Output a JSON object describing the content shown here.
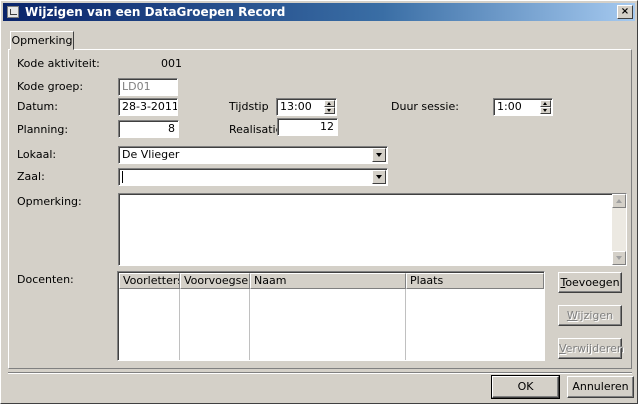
{
  "window": {
    "title": "Wijzigen van een DataGroepen Record",
    "close_label": "×"
  },
  "tabs": [
    {
      "label": "Opmerking"
    }
  ],
  "form": {
    "kode_aktiviteit_label": "Kode aktiviteit:",
    "kode_aktiviteit_value": "001",
    "kode_groep_label": "Kode groep:",
    "kode_groep_value": "LD01",
    "datum_label": "Datum:",
    "datum_value": "28-3-2011",
    "tijdstip_label": "Tijdstip",
    "tijdstip_value": "13:00",
    "duur_label": "Duur sessie:",
    "duur_value": "1:00",
    "planning_label": "Planning:",
    "planning_value": "8",
    "realisatie_label": "Realisatie:",
    "realisatie_value": "12",
    "lokaal_label": "Lokaal:",
    "lokaal_value": "De Vlieger",
    "zaal_label": "Zaal:",
    "zaal_value": "",
    "opmerking_label": "Opmerking:",
    "opmerking_value": "",
    "docenten_label": "Docenten:"
  },
  "docenten_table": {
    "columns": [
      "Voorletters",
      "Voorvoegsel",
      "Naam",
      "Plaats"
    ],
    "rows": []
  },
  "side_buttons": {
    "toevoegen_accel": "T",
    "toevoegen_rest": "oevoegen",
    "wijzigen_accel": "W",
    "wijzigen_rest": "ijzigen",
    "verwijderen_accel": "V",
    "verwijderen_rest": "erwijderen"
  },
  "footer": {
    "ok_label": "OK",
    "annuleren_label": "Annuleren"
  },
  "colors": {
    "titlebar_start": "#0a246a",
    "titlebar_end": "#a6caf0",
    "face": "#d4d0c8"
  }
}
